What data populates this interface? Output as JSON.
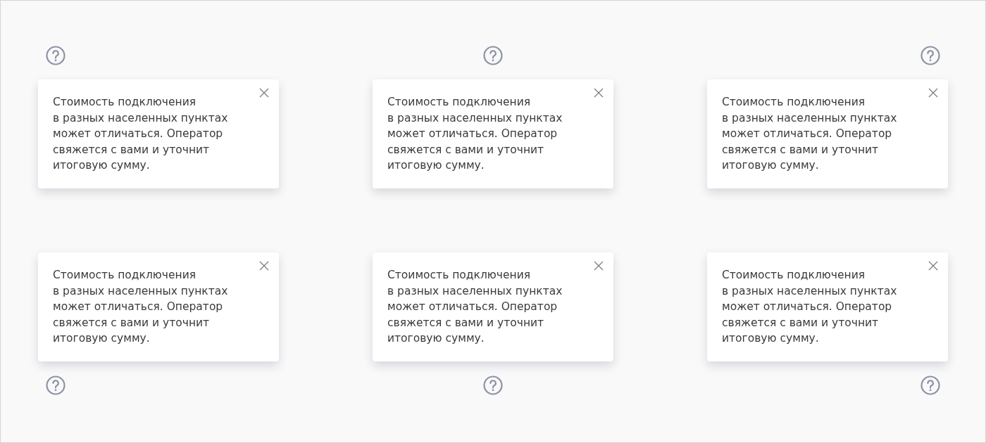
{
  "tooltips": [
    {
      "kind": "topleft",
      "text": "Стоимость подключения\nв разных населенных пунктах\nможет отличаться. Оператор\nсвяжется с вами и уточнит\nитоговую сумму."
    },
    {
      "kind": "top",
      "text": "Стоимость подключения\nв разных населенных пунктах\nможет отличаться. Оператор\nсвяжется с вами и уточнит\nитоговую сумму."
    },
    {
      "kind": "topright",
      "text": "Стоимость подключения\nв разных населенных пунктах\nможет отличаться. Оператор\nсвяжется с вами и уточнит\nитоговую сумму."
    },
    {
      "kind": "bottomleft",
      "text": "Стоимость подключения\nв разных населенных пунктах\nможет отличаться. Оператор\nсвяжется с вами и уточнит\nитоговую сумму."
    },
    {
      "kind": "bottom",
      "text": "Стоимость подключения\nв разных населенных пунктах\nможет отличаться. Оператор\nсвяжется с вами и уточнит\nитоговую сумму."
    },
    {
      "kind": "bottomright",
      "text": "Стоимость подключения\nв разных населенных пунктах\nможет отличаться. Оператор\nсвяжется с вами и уточнит\nитоговую сумму."
    }
  ]
}
